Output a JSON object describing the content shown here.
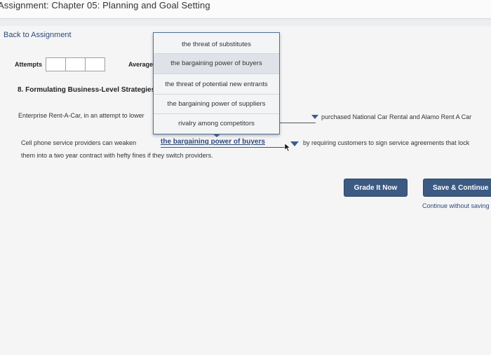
{
  "window": {
    "title": "Assignment: Chapter 05: Planning and Goal Setting"
  },
  "nav": {
    "back_label": "Back to Assignment"
  },
  "attempts": {
    "label": "Attempts",
    "average_label": "Average"
  },
  "question": {
    "heading": "8. Formulating Business-Level Strategies",
    "text1_start": "Enterprise Rent-A-Car, in an attempt to lower",
    "text1_end": "purchased National Car Rental and Alamo Rent A Car",
    "text2_start": "Cell phone service providers can weaken",
    "text2_selected": "the bargaining power of buyers",
    "text2_end": "by requiring customers to sign service agreements that lock",
    "text2_line2": "them into a two year contract with hefty fines if they switch providers."
  },
  "dropdown": {
    "options": [
      "the threat of substitutes",
      "the bargaining power of buyers",
      "the threat of potential new entrants",
      "the bargaining power of suppliers",
      "rivalry among competitors"
    ],
    "selected": "the bargaining power of buyers"
  },
  "actions": {
    "grade_label": "Grade It Now",
    "save_label": "Save & Continue",
    "continue_label": "Continue without saving"
  },
  "colors": {
    "accent": "#3c5a82",
    "link": "#2e4a7a"
  }
}
